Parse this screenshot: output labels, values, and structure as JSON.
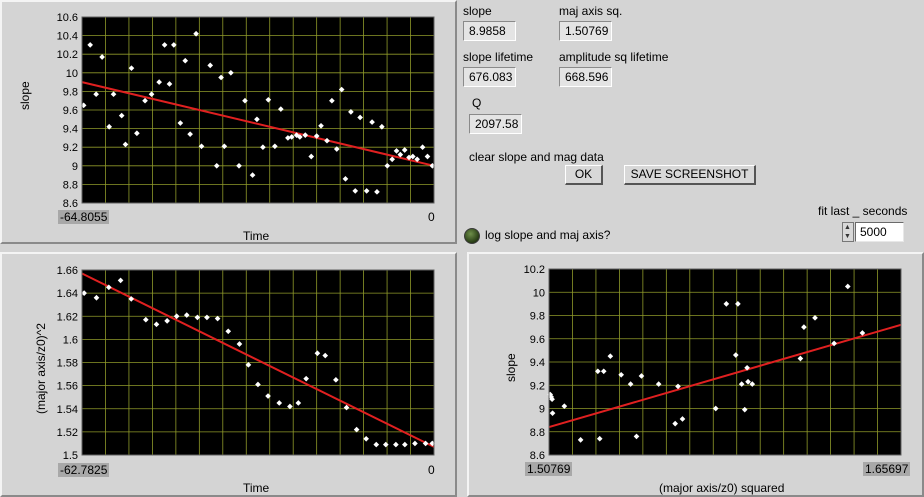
{
  "charts": {
    "slope_time": {
      "ylabel": "slope",
      "xlabel": "Time",
      "x_min_label": "-64.8055",
      "x_max_label": "0",
      "y_ticks": [
        "10.6",
        "10.4",
        "10.2",
        "10",
        "9.8",
        "9.6",
        "9.4",
        "9.2",
        "9",
        "8.8",
        "8.6"
      ]
    },
    "major_time": {
      "ylabel": "(major axis/z0)^2",
      "xlabel": "Time",
      "x_min_label": "-62.7825",
      "x_max_label": "0",
      "y_ticks": [
        "1.66",
        "1.64",
        "1.62",
        "1.6",
        "1.58",
        "1.56",
        "1.54",
        "1.52",
        "1.5"
      ]
    },
    "slope_major": {
      "ylabel": "slope",
      "xlabel": "(major axis/z0) squared",
      "x_min_label": "1.50769",
      "x_max_label": "1.65697",
      "y_ticks": [
        "10.2",
        "10",
        "9.8",
        "9.6",
        "9.4",
        "9.2",
        "9",
        "8.8",
        "8.6"
      ]
    }
  },
  "chart_data": [
    {
      "type": "scatter",
      "ylabel": "slope",
      "xlabel": "Time",
      "xlim": [
        -64.8055,
        0
      ],
      "ylim": [
        8.6,
        10.6
      ],
      "grid": true,
      "colors": {
        "points": "#ffffff",
        "fit": "#e02020",
        "background": "#000000",
        "grid": "#8f9a2a"
      },
      "x": [
        -64.5,
        -63.3,
        -62.2,
        -61.1,
        -59.8,
        -59.0,
        -57.5,
        -56.8,
        -55.7,
        -54.7,
        -53.2,
        -52.0,
        -50.6,
        -49.6,
        -48.7,
        -47.9,
        -46.7,
        -45.8,
        -44.9,
        -43.8,
        -42.8,
        -41.2,
        -40.0,
        -39.2,
        -38.6,
        -37.4,
        -35.9,
        -34.8,
        -33.4,
        -32.6,
        -31.5,
        -30.5,
        -29.3,
        -28.2,
        -26.9,
        -26.2,
        -25.3,
        -24.7,
        -23.7,
        -22.6,
        -21.6,
        -20.8,
        -19.7,
        -18.8,
        -17.9,
        -17.0,
        -16.3,
        -15.3,
        -14.5,
        -13.6,
        -12.4,
        -11.4,
        -10.5,
        -9.6,
        -8.6,
        -7.7,
        -6.9,
        -6.2,
        -5.4,
        -4.6,
        -3.9,
        -3.1,
        -2.1,
        -1.2,
        -0.3
      ],
      "y": [
        9.65,
        10.3,
        9.77,
        10.17,
        9.42,
        9.77,
        9.54,
        9.23,
        10.05,
        9.35,
        9.7,
        9.77,
        9.9,
        10.3,
        9.88,
        10.3,
        9.46,
        10.13,
        9.34,
        10.42,
        9.21,
        10.08,
        9.0,
        9.95,
        9.21,
        10.0,
        9.0,
        9.7,
        8.9,
        9.5,
        9.2,
        9.71,
        9.21,
        9.61,
        9.3,
        9.31,
        9.33,
        9.31,
        9.33,
        9.1,
        9.32,
        9.43,
        9.27,
        9.7,
        9.18,
        9.82,
        8.86,
        9.58,
        8.73,
        9.52,
        8.73,
        9.47,
        8.72,
        9.42,
        9.0,
        9.07,
        9.16,
        9.12,
        9.17,
        9.09,
        9.1,
        9.07,
        9.2,
        9.1,
        9.0
      ],
      "fit_line": {
        "x": [
          -64.8055,
          0
        ],
        "y": [
          9.9,
          9.0
        ]
      }
    },
    {
      "type": "scatter",
      "ylabel": "(major axis/z0)^2",
      "xlabel": "Time",
      "xlim": [
        -62.7825,
        0
      ],
      "ylim": [
        1.5,
        1.66
      ],
      "grid": true,
      "colors": {
        "points": "#ffffff",
        "fit": "#e02020",
        "background": "#000000",
        "grid": "#8f9a2a"
      },
      "x": [
        -62.4,
        -60.2,
        -58.0,
        -55.9,
        -54.0,
        -51.4,
        -49.5,
        -47.6,
        -45.9,
        -44.1,
        -42.2,
        -40.5,
        -38.6,
        -36.7,
        -34.7,
        -33.1,
        -31.4,
        -29.6,
        -27.6,
        -25.7,
        -24.2,
        -22.8,
        -20.8,
        -19.4,
        -17.5,
        -15.6,
        -13.8,
        -12.1,
        -10.3,
        -8.6,
        -6.8,
        -5.2,
        -3.4,
        -1.5,
        -0.3
      ],
      "y": [
        1.64,
        1.636,
        1.645,
        1.651,
        1.635,
        1.617,
        1.613,
        1.616,
        1.62,
        1.621,
        1.619,
        1.619,
        1.618,
        1.607,
        1.596,
        1.578,
        1.561,
        1.551,
        1.545,
        1.542,
        1.545,
        1.566,
        1.588,
        1.586,
        1.565,
        1.541,
        1.522,
        1.514,
        1.509,
        1.509,
        1.509,
        1.509,
        1.51,
        1.51,
        1.51
      ],
      "fit_line": {
        "x": [
          -62.7825,
          0
        ],
        "y": [
          1.657,
          1.507
        ]
      }
    },
    {
      "type": "scatter",
      "ylabel": "slope",
      "xlabel": "(major axis/z0) squared",
      "xlim": [
        1.50769,
        1.65697
      ],
      "ylim": [
        8.6,
        10.2
      ],
      "grid": true,
      "colors": {
        "points": "#ffffff",
        "fit": "#e02020",
        "background": "#000000",
        "grid": "#8f9a2a"
      },
      "x": [
        1.5082,
        1.5086,
        1.509,
        1.5092,
        1.5142,
        1.5211,
        1.5284,
        1.5292,
        1.5309,
        1.5337,
        1.5383,
        1.5423,
        1.5448,
        1.5469,
        1.5542,
        1.5612,
        1.5624,
        1.5643,
        1.5784,
        1.5829,
        1.5869,
        1.5878,
        1.5894,
        1.5907,
        1.5917,
        1.5921,
        1.5939,
        1.6143,
        1.6158,
        1.6205,
        1.6286,
        1.6344,
        1.6406
      ],
      "y": [
        9.12,
        9.1,
        9.08,
        8.96,
        9.02,
        8.73,
        9.32,
        8.74,
        9.32,
        9.45,
        9.29,
        9.21,
        8.76,
        9.28,
        9.21,
        8.87,
        9.19,
        8.91,
        9.0,
        9.9,
        9.46,
        9.9,
        9.21,
        8.99,
        9.35,
        9.23,
        9.21,
        9.43,
        9.7,
        9.78,
        9.56,
        10.05,
        9.65
      ],
      "fit_line": {
        "x": [
          1.50769,
          1.65697
        ],
        "y": [
          8.84,
          9.72
        ]
      }
    }
  ],
  "indicators": {
    "slope_label": "slope",
    "slope_value": "8.9858",
    "maj_label": "maj axis sq.",
    "maj_value": "1.50769",
    "slope_lifetime_label": "slope lifetime",
    "slope_lifetime_value": "676.083",
    "amp_lifetime_label": "amplitude sq lifetime",
    "amp_lifetime_value": "668.596",
    "q_label": "Q",
    "q_value": "2097.58"
  },
  "controls": {
    "clear_label": "clear slope and mag data",
    "ok_button": "OK",
    "screenshot_button": "SAVE SCREENSHOT",
    "log_label": "log slope and maj axis?",
    "fit_label": "fit last _ seconds",
    "fit_value": "5000"
  }
}
